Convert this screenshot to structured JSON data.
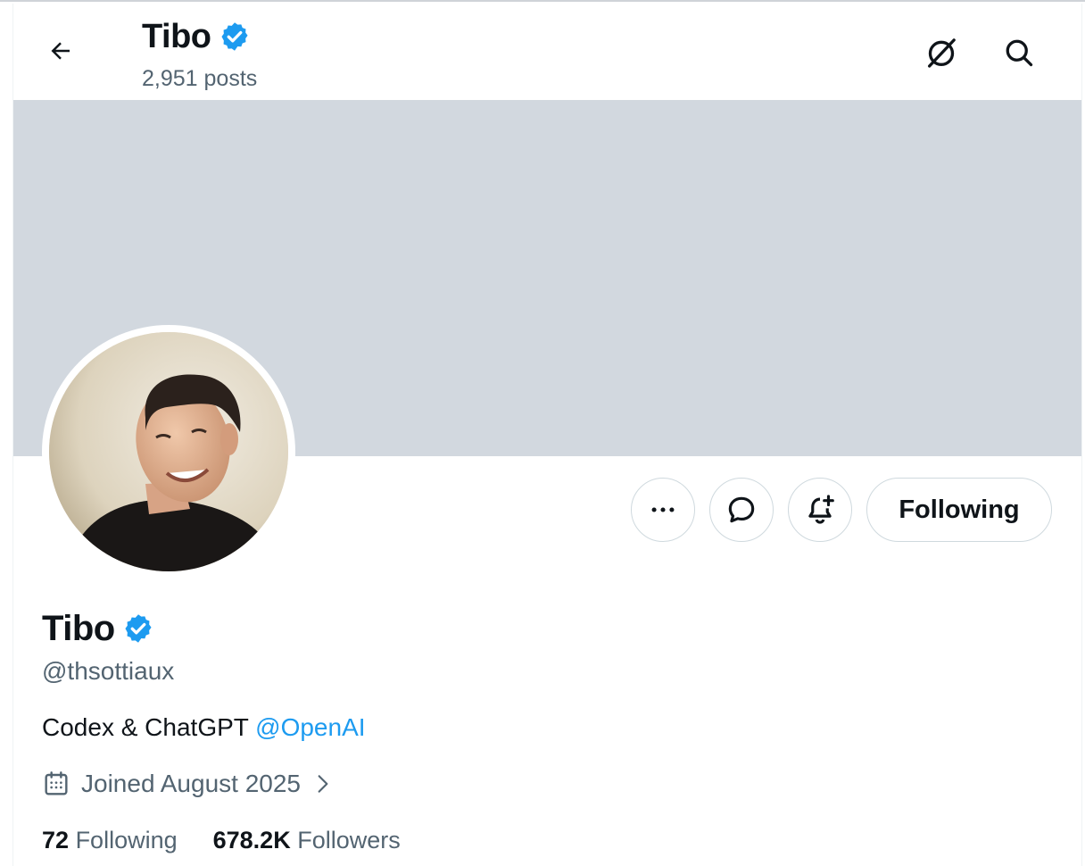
{
  "header": {
    "name": "Tibo",
    "posts_count": "2,951 posts",
    "icons": [
      "back-arrow-icon",
      "verified-badge-icon",
      "grok-icon",
      "search-icon"
    ]
  },
  "profile": {
    "name": "Tibo",
    "handle": "@thsottiaux",
    "bio_text": "Codex & ChatGPT ",
    "bio_mention": "@OpenAI",
    "joined": "Joined August 2025",
    "following_count": "72",
    "following_label": "Following",
    "followers_count": "678.2K",
    "followers_label": "Followers"
  },
  "actions": {
    "more_icon": "more-dots-icon",
    "message_icon": "message-bubble-icon",
    "notify_icon": "bell-plus-icon",
    "follow_state_label": "Following"
  },
  "colors": {
    "accent": "#1d9bf0",
    "banner": "#d2d8df",
    "secondary_text": "#536471",
    "primary_text": "#0f1419",
    "border": "#cfd9de"
  }
}
